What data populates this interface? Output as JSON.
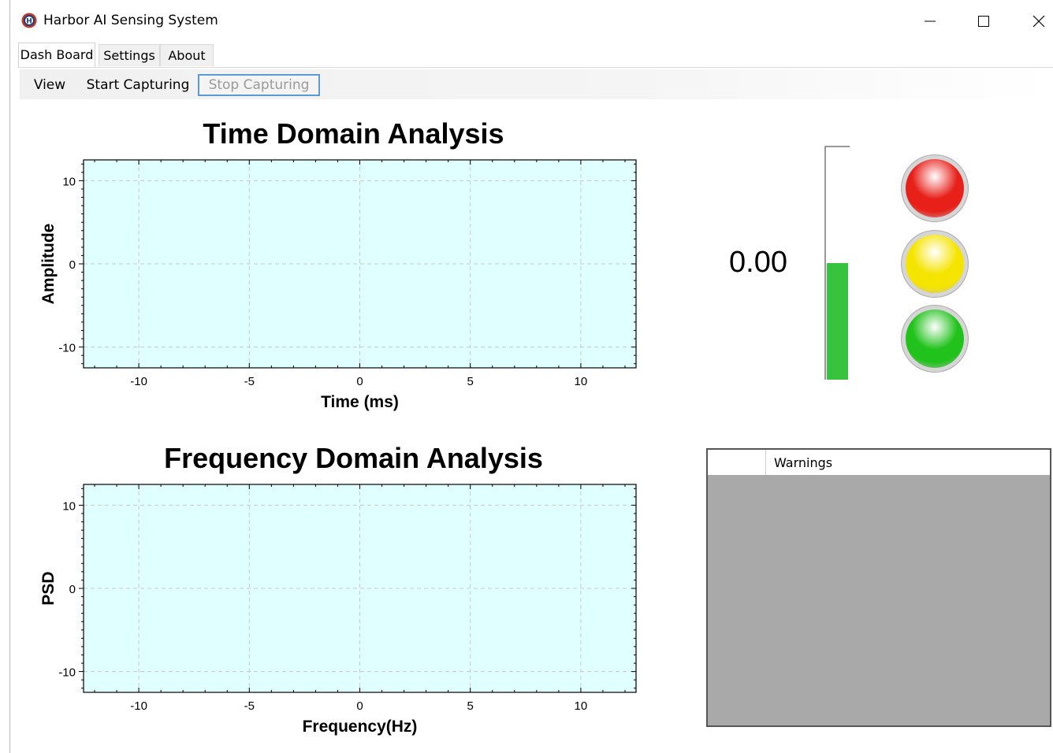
{
  "window": {
    "title": "Harbor AI Sensing System",
    "controls": {
      "minimize": "—",
      "maximize": "☐",
      "close": "✕"
    }
  },
  "tabs": [
    {
      "label": "Dash Board",
      "active": true
    },
    {
      "label": "Settings",
      "active": false
    },
    {
      "label": "About",
      "active": false
    }
  ],
  "toolbar": {
    "view": "View",
    "start": "Start Capturing",
    "stop": "Stop Capturing"
  },
  "chart_data": [
    {
      "type": "line",
      "title": "Time Domain Analysis",
      "xlabel": "Time (ms)",
      "ylabel": "Amplitude",
      "xlim": [
        -12.5,
        12.5
      ],
      "ylim": [
        -12.5,
        12.5
      ],
      "xticks": [
        -10,
        -5,
        0,
        5,
        10
      ],
      "yticks": [
        10,
        0,
        -10
      ],
      "grid": true,
      "background": "#e0ffff",
      "series": []
    },
    {
      "type": "line",
      "title": "Frequency Domain Analysis",
      "xlabel": "Frequency(Hz)",
      "ylabel": "PSD",
      "xlim": [
        -12.5,
        12.5
      ],
      "ylim": [
        -12.5,
        12.5
      ],
      "xticks": [
        -10,
        -5,
        0,
        5,
        10
      ],
      "yticks": [
        10,
        0,
        -10
      ],
      "grid": true,
      "background": "#e0ffff",
      "series": []
    }
  ],
  "gauge": {
    "value_text": "0.00",
    "level": 0.5,
    "bar_color": "#36c43e"
  },
  "status_lights": [
    {
      "name": "red",
      "color": "#e8201a"
    },
    {
      "name": "yellow",
      "color": "#f5e400"
    },
    {
      "name": "green",
      "color": "#22c21c"
    }
  ],
  "warnings": {
    "header": "Warnings",
    "items": []
  }
}
